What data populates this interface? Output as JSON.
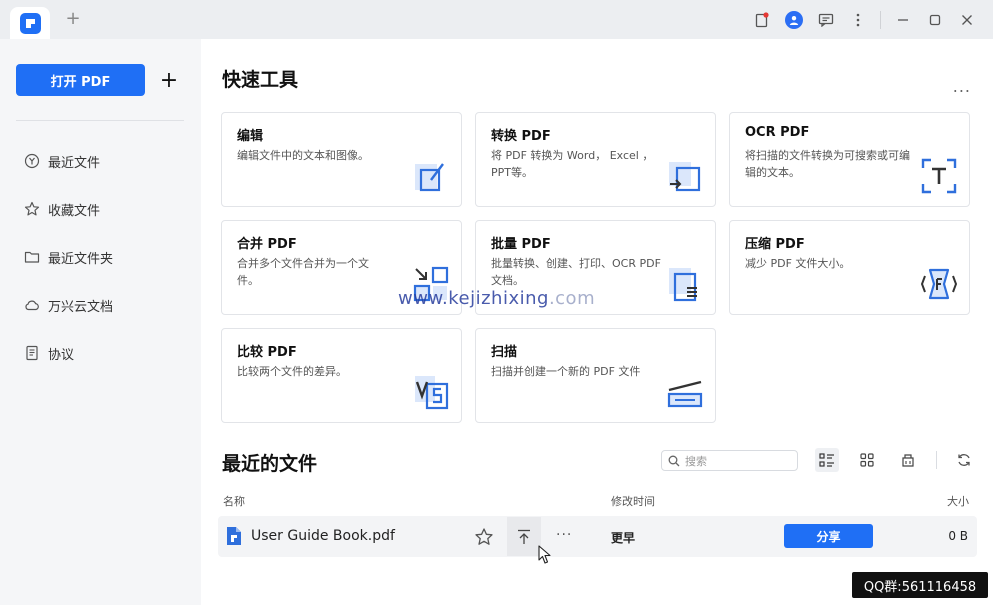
{
  "titlebar": {
    "new_tab": "+",
    "icons": [
      "notification-icon",
      "user-avatar",
      "feedback-icon",
      "more-vertical-icon",
      "minimize-icon",
      "maximize-icon",
      "close-icon"
    ]
  },
  "sidebar": {
    "open_label": "打开 PDF",
    "plus_label": "+",
    "items": [
      {
        "label": "最近文件",
        "icon": "recent-icon"
      },
      {
        "label": "收藏文件",
        "icon": "star-icon"
      },
      {
        "label": "最近文件夹",
        "icon": "folder-icon"
      },
      {
        "label": "万兴云文档",
        "icon": "cloud-icon"
      },
      {
        "label": "协议",
        "icon": "document-icon"
      }
    ]
  },
  "quick_tools": {
    "title": "快速工具",
    "more": "...",
    "cards": [
      {
        "title": "编辑",
        "desc": "编辑文件中的文本和图像。"
      },
      {
        "title": "转换 PDF",
        "desc": "将 PDF 转换为 Word， Excel ，PPT等。"
      },
      {
        "title": "OCR PDF",
        "desc": "将扫描的文件转换为可搜索或可编辑的文本。"
      },
      {
        "title": "合并 PDF",
        "desc": "合并多个文件合并为一个文件。"
      },
      {
        "title": "批量 PDF",
        "desc": "批量转换、创建、打印、OCR PDF 文档。"
      },
      {
        "title": "压缩 PDF",
        "desc": "减少 PDF 文件大小。"
      },
      {
        "title": "比较 PDF",
        "desc": "比较两个文件的差异。"
      },
      {
        "title": "扫描",
        "desc": "扫描并创建一个新的 PDF 文件"
      }
    ]
  },
  "recent": {
    "title": "最近的文件",
    "search_placeholder": "搜索",
    "columns": {
      "name": "名称",
      "modified": "修改时间",
      "size": "大小"
    },
    "rows": [
      {
        "name": "User Guide Book.pdf",
        "more": "···",
        "modified": "更早",
        "share": "分享",
        "size": "0 B"
      }
    ]
  },
  "watermark": {
    "main": "www.kejizhixing",
    "suffix": ".com"
  },
  "overlay": {
    "qq": "QQ群:561116458"
  },
  "colors": {
    "accent": "#1f6ff5"
  }
}
